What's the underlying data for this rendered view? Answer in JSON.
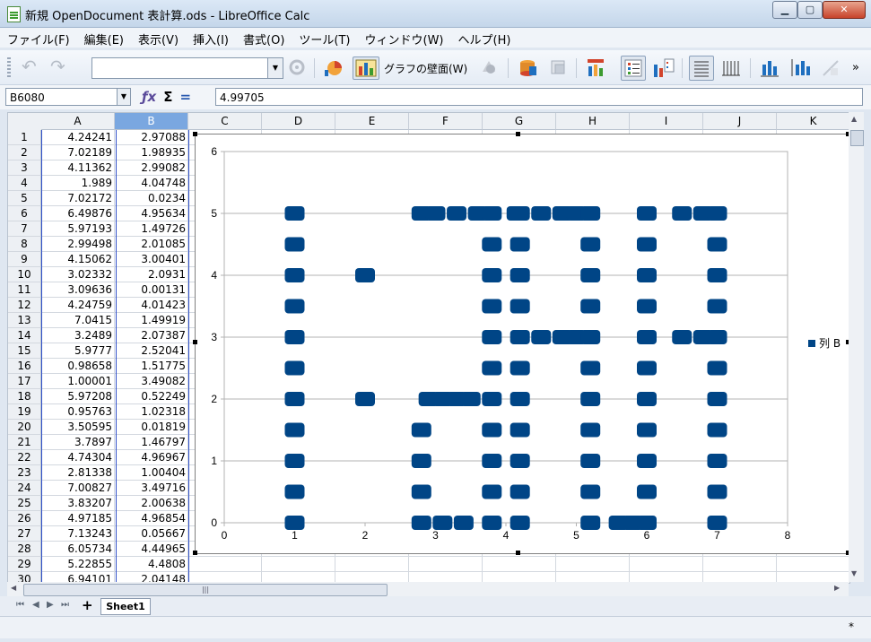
{
  "window": {
    "title": "新規 OpenDocument 表計算.ods - LibreOffice Calc",
    "min_label": "▁",
    "max_label": "▢",
    "close_label": "✕"
  },
  "menu": [
    "ファイル(F)",
    "編集(E)",
    "表示(V)",
    "挿入(I)",
    "書式(O)",
    "ツール(T)",
    "ウィンドウ(W)",
    "ヘルプ(H)"
  ],
  "toolbar": {
    "object_select_value": "",
    "chart_wall_label": "グラフの壁面(W)",
    "more": "»"
  },
  "formula_bar": {
    "name_box": "B6080",
    "formula": "4.99705"
  },
  "sheet": {
    "columns": [
      "A",
      "B",
      "C",
      "D",
      "E",
      "F",
      "G",
      "H",
      "I",
      "J",
      "K"
    ],
    "selected_column": "B",
    "rows": [
      {
        "n": "1",
        "a": "4.24241",
        "b": "2.97088"
      },
      {
        "n": "2",
        "a": "7.02189",
        "b": "1.98935"
      },
      {
        "n": "3",
        "a": "4.11362",
        "b": "2.99082"
      },
      {
        "n": "4",
        "a": "1.989",
        "b": "4.04748"
      },
      {
        "n": "5",
        "a": "7.02172",
        "b": "0.0234"
      },
      {
        "n": "6",
        "a": "6.49876",
        "b": "4.95634"
      },
      {
        "n": "7",
        "a": "5.97193",
        "b": "1.49726"
      },
      {
        "n": "8",
        "a": "2.99498",
        "b": "2.01085"
      },
      {
        "n": "9",
        "a": "4.15062",
        "b": "3.00401"
      },
      {
        "n": "10",
        "a": "3.02332",
        "b": "2.0931"
      },
      {
        "n": "11",
        "a": "3.09636",
        "b": "0.00131"
      },
      {
        "n": "12",
        "a": "4.24759",
        "b": "4.01423"
      },
      {
        "n": "13",
        "a": "7.0415",
        "b": "1.49919"
      },
      {
        "n": "14",
        "a": "3.2489",
        "b": "2.07387"
      },
      {
        "n": "15",
        "a": "5.9777",
        "b": "2.52041"
      },
      {
        "n": "16",
        "a": "0.98658",
        "b": "1.51775"
      },
      {
        "n": "17",
        "a": "1.00001",
        "b": "3.49082"
      },
      {
        "n": "18",
        "a": "5.97208",
        "b": "0.52249"
      },
      {
        "n": "19",
        "a": "0.95763",
        "b": "1.02318"
      },
      {
        "n": "20",
        "a": "3.50595",
        "b": "0.01819"
      },
      {
        "n": "21",
        "a": "3.7897",
        "b": "1.46797"
      },
      {
        "n": "22",
        "a": "4.74304",
        "b": "4.96967"
      },
      {
        "n": "23",
        "a": "2.81338",
        "b": "1.00404"
      },
      {
        "n": "24",
        "a": "7.00827",
        "b": "3.49716"
      },
      {
        "n": "25",
        "a": "3.83207",
        "b": "2.00638"
      },
      {
        "n": "26",
        "a": "4.97185",
        "b": "4.96854"
      },
      {
        "n": "27",
        "a": "7.13243",
        "b": "0.05667"
      },
      {
        "n": "28",
        "a": "6.05734",
        "b": "4.44965"
      },
      {
        "n": "29",
        "a": "5.22855",
        "b": "4.4808"
      },
      {
        "n": "30",
        "a": "6.94101",
        "b": "2.04148"
      }
    ]
  },
  "chart_data": {
    "type": "scatter",
    "xlim": [
      0,
      8
    ],
    "ylim": [
      0,
      6
    ],
    "xticks": [
      "0",
      "1",
      "2",
      "3",
      "4",
      "5",
      "6",
      "7",
      "8"
    ],
    "yticks": [
      "0",
      "1",
      "2",
      "3",
      "4",
      "5",
      "6"
    ],
    "grid": "horizontal",
    "legend_position": "right",
    "series": [
      {
        "name": "列 B",
        "color": "#004586",
        "points": [
          [
            1.0,
            5.0
          ],
          [
            1.0,
            4.5
          ],
          [
            1.0,
            4.0
          ],
          [
            1.0,
            3.5
          ],
          [
            1.0,
            3.0
          ],
          [
            1.0,
            2.5
          ],
          [
            1.0,
            2.0
          ],
          [
            1.0,
            1.5
          ],
          [
            1.0,
            1.0
          ],
          [
            1.0,
            0.5
          ],
          [
            1.0,
            0.0
          ],
          [
            2.0,
            4.0
          ],
          [
            2.0,
            2.0
          ],
          [
            2.8,
            5.0
          ],
          [
            3.0,
            5.0
          ],
          [
            3.3,
            5.0
          ],
          [
            3.6,
            5.0
          ],
          [
            3.8,
            5.0
          ],
          [
            4.15,
            5.0
          ],
          [
            2.9,
            2.0
          ],
          [
            3.1,
            2.0
          ],
          [
            3.3,
            2.0
          ],
          [
            3.5,
            2.0
          ],
          [
            3.8,
            2.0
          ],
          [
            2.8,
            1.5
          ],
          [
            2.8,
            1.0
          ],
          [
            2.8,
            0.5
          ],
          [
            2.8,
            0.0
          ],
          [
            3.1,
            0.0
          ],
          [
            3.4,
            0.0
          ],
          [
            3.8,
            0.0
          ],
          [
            3.8,
            4.5
          ],
          [
            3.8,
            4.0
          ],
          [
            3.8,
            3.5
          ],
          [
            3.8,
            3.0
          ],
          [
            3.8,
            2.5
          ],
          [
            3.8,
            1.5
          ],
          [
            3.8,
            1.0
          ],
          [
            3.8,
            0.5
          ],
          [
            4.2,
            5.0
          ],
          [
            4.5,
            5.0
          ],
          [
            4.8,
            5.0
          ],
          [
            5.0,
            5.0
          ],
          [
            5.2,
            5.0
          ],
          [
            4.2,
            4.5
          ],
          [
            4.2,
            4.0
          ],
          [
            4.2,
            3.5
          ],
          [
            4.2,
            3.0
          ],
          [
            4.5,
            3.0
          ],
          [
            4.8,
            3.0
          ],
          [
            5.0,
            3.0
          ],
          [
            5.2,
            3.0
          ],
          [
            4.2,
            2.5
          ],
          [
            4.2,
            2.0
          ],
          [
            4.2,
            1.5
          ],
          [
            4.2,
            1.0
          ],
          [
            4.2,
            0.5
          ],
          [
            4.2,
            0.0
          ],
          [
            5.2,
            4.5
          ],
          [
            5.2,
            4.0
          ],
          [
            5.2,
            3.5
          ],
          [
            5.2,
            2.5
          ],
          [
            5.2,
            2.0
          ],
          [
            5.2,
            1.5
          ],
          [
            5.2,
            1.0
          ],
          [
            5.2,
            0.5
          ],
          [
            5.2,
            0.0
          ],
          [
            5.6,
            0.0
          ],
          [
            5.8,
            0.0
          ],
          [
            6.0,
            0.0
          ],
          [
            6.0,
            5.0
          ],
          [
            6.0,
            4.5
          ],
          [
            6.0,
            4.0
          ],
          [
            6.0,
            3.5
          ],
          [
            6.0,
            3.0
          ],
          [
            6.0,
            2.5
          ],
          [
            6.0,
            2.0
          ],
          [
            6.0,
            1.5
          ],
          [
            6.0,
            1.0
          ],
          [
            6.0,
            0.5
          ],
          [
            6.5,
            5.0
          ],
          [
            6.8,
            5.0
          ],
          [
            7.0,
            5.0
          ],
          [
            7.0,
            4.5
          ],
          [
            7.0,
            4.0
          ],
          [
            7.0,
            3.5
          ],
          [
            6.5,
            3.0
          ],
          [
            6.8,
            3.0
          ],
          [
            7.0,
            3.0
          ],
          [
            7.0,
            2.5
          ],
          [
            7.0,
            2.0
          ],
          [
            7.0,
            1.5
          ],
          [
            7.0,
            1.0
          ],
          [
            7.0,
            0.5
          ],
          [
            7.0,
            0.0
          ]
        ]
      }
    ]
  },
  "tabs": {
    "sheet1": "Sheet1",
    "add": "+"
  },
  "status": {
    "mark": "*"
  }
}
